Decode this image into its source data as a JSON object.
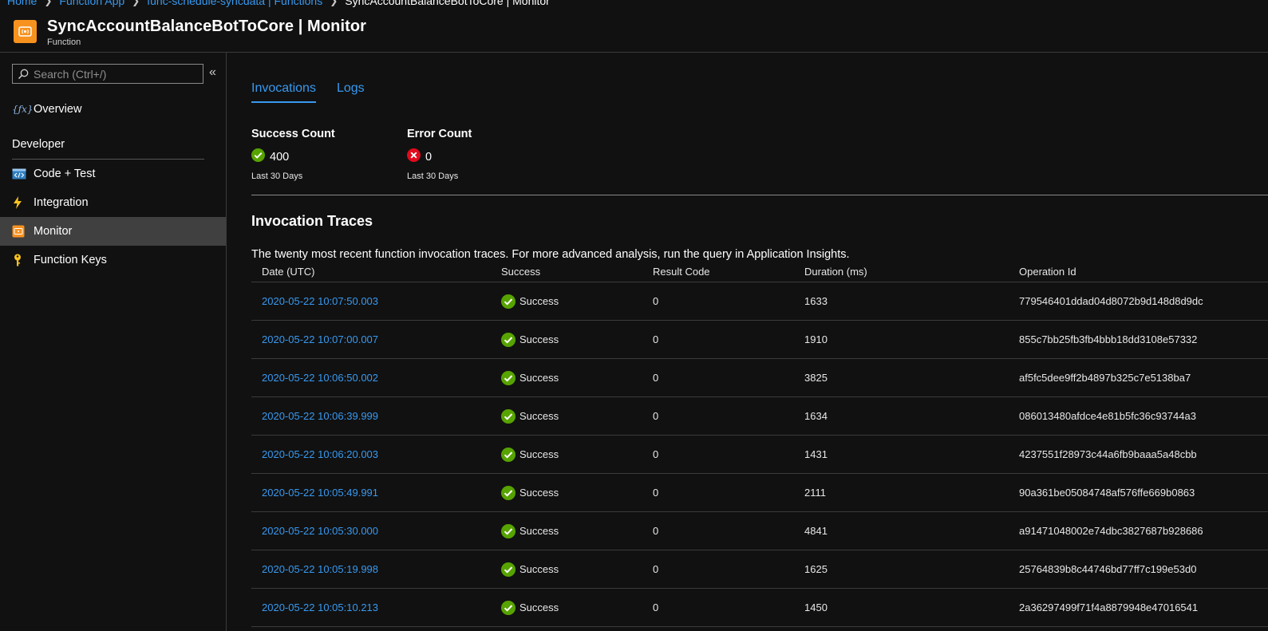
{
  "breadcrumb": {
    "items": [
      "Home",
      "Function App",
      "func-schedule-syncdata | Functions"
    ],
    "current": "SyncAccountBalanceBotToCore | Monitor"
  },
  "header": {
    "title": "SyncAccountBalanceBotToCore | Monitor",
    "subtitle": "Function",
    "icon": "function-monitor-icon"
  },
  "sidebar": {
    "search_placeholder": "Search (Ctrl+/)",
    "collapse_label": "«",
    "overview": {
      "label": "Overview",
      "icon": "function-icon"
    },
    "section_label": "Developer",
    "items": [
      {
        "label": "Code + Test",
        "icon": "code-icon"
      },
      {
        "label": "Integration",
        "icon": "lightning-icon"
      },
      {
        "label": "Monitor",
        "icon": "monitor-icon",
        "active": true
      },
      {
        "label": "Function Keys",
        "icon": "key-icon"
      }
    ]
  },
  "main": {
    "tabs": [
      {
        "label": "Invocations",
        "active": true
      },
      {
        "label": "Logs",
        "active": false
      }
    ],
    "success": {
      "label": "Success Count",
      "value": "400",
      "period": "Last 30 Days"
    },
    "error": {
      "label": "Error Count",
      "value": "0",
      "period": "Last 30 Days"
    },
    "traces_title": "Invocation Traces",
    "traces_desc": "The twenty most recent function invocation traces. For more advanced analysis, run the query in Application Insights.",
    "columns": [
      "Date (UTC)",
      "Success",
      "Result Code",
      "Duration (ms)",
      "Operation Id"
    ],
    "rows": [
      {
        "date": "2020-05-22 10:07:50.003",
        "success": "Success",
        "code": "0",
        "duration": "1633",
        "op": "779546401ddad04d8072b9d148d8d9dc"
      },
      {
        "date": "2020-05-22 10:07:00.007",
        "success": "Success",
        "code": "0",
        "duration": "1910",
        "op": "855c7bb25fb3fb4bbb18dd3108e57332"
      },
      {
        "date": "2020-05-22 10:06:50.002",
        "success": "Success",
        "code": "0",
        "duration": "3825",
        "op": "af5fc5dee9ff2b4897b325c7e5138ba7"
      },
      {
        "date": "2020-05-22 10:06:39.999",
        "success": "Success",
        "code": "0",
        "duration": "1634",
        "op": "086013480afdce4e81b5fc36c93744a3"
      },
      {
        "date": "2020-05-22 10:06:20.003",
        "success": "Success",
        "code": "0",
        "duration": "1431",
        "op": "4237551f28973c44a6fb9baaa5a48cbb"
      },
      {
        "date": "2020-05-22 10:05:49.991",
        "success": "Success",
        "code": "0",
        "duration": "2111",
        "op": "90a361be05084748af576ffe669b0863"
      },
      {
        "date": "2020-05-22 10:05:30.000",
        "success": "Success",
        "code": "0",
        "duration": "4841",
        "op": "a91471048002e74dbc3827687b928686"
      },
      {
        "date": "2020-05-22 10:05:19.998",
        "success": "Success",
        "code": "0",
        "duration": "1625",
        "op": "25764839b8c44746bd77ff7c199e53d0"
      },
      {
        "date": "2020-05-22 10:05:10.213",
        "success": "Success",
        "code": "0",
        "duration": "1450",
        "op": "2a36297499f71f4a8879948e47016541"
      }
    ]
  },
  "colors": {
    "link": "#3899f0",
    "success": "#57a300",
    "error": "#e00b1c",
    "accent_orange": "#f7921e"
  }
}
